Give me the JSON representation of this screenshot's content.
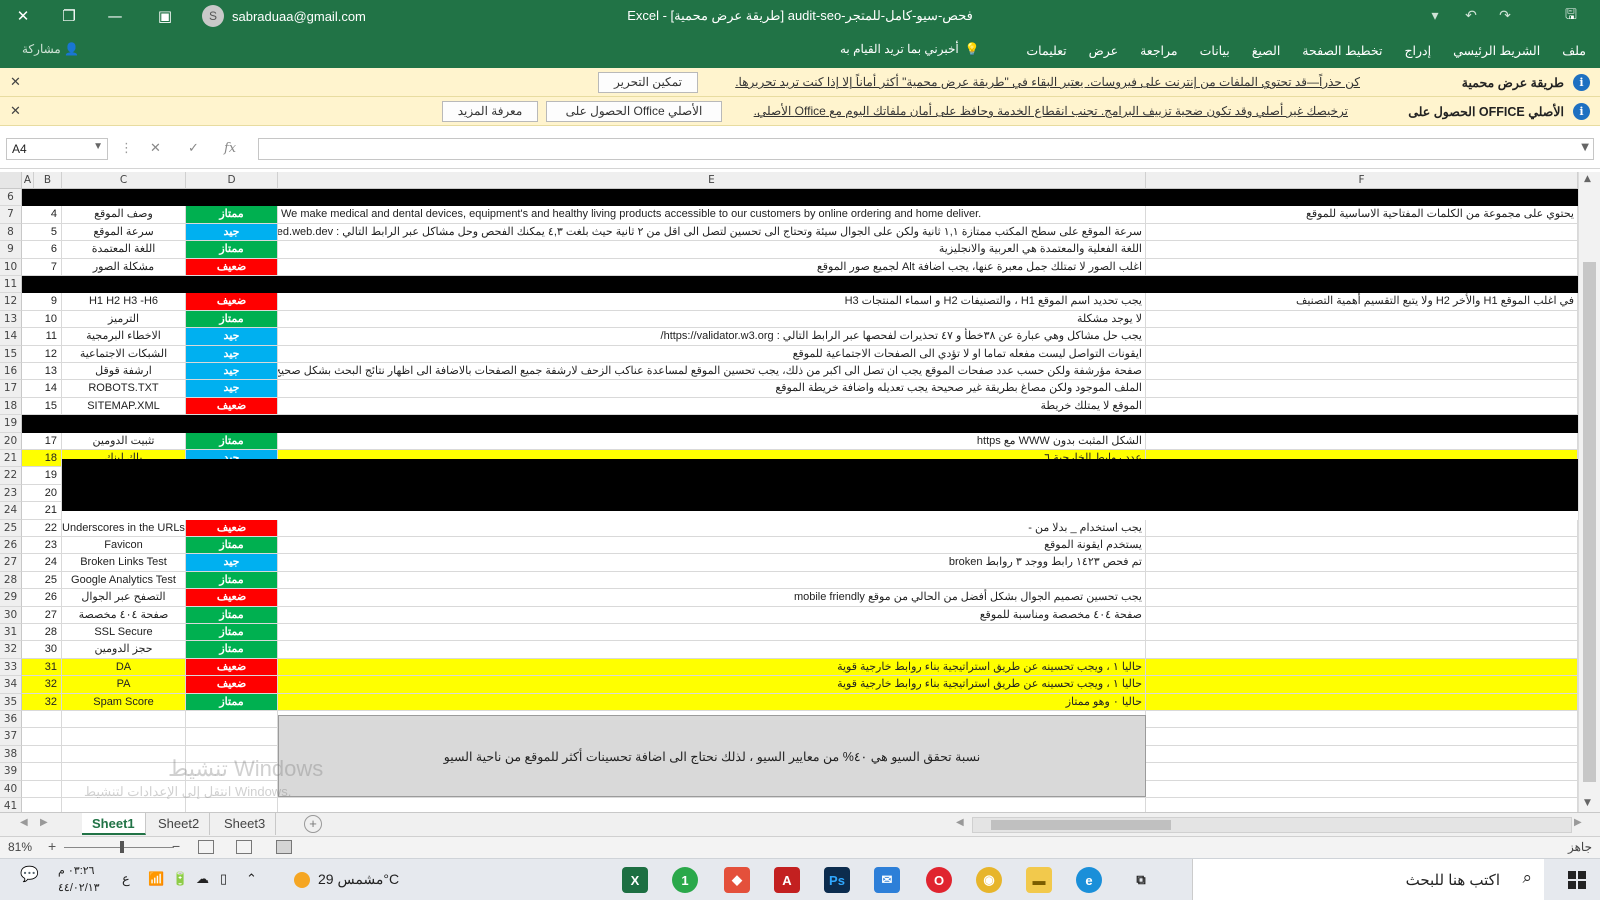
{
  "titlebar": {
    "account_email": "sabraduaa@gmail.com",
    "avatar_initial": "S",
    "document_title": "Excel - [طريقة عرض محمية] audit-seo-فحص-سيو-كامل-للمتجر"
  },
  "ribbon": {
    "share_label": "مشاركة",
    "tell_me": "أخبرني بما تريد القيام به",
    "tabs": [
      "ملف",
      "الشريط الرئيسي",
      "إدراج",
      "تخطيط الصفحة",
      "الصيغ",
      "بيانات",
      "مراجعة",
      "عرض",
      "تعليمات"
    ]
  },
  "protected_bar": {
    "title": "طريقة عرض محمية",
    "message": "كن حذراً—قد تحتوي الملفات من إنترنت على فيروسات. يعتبر البقاء في \"طريقة عرض محمية\" أكثر أماناً إلا إذا كنت تريد تحريرها.",
    "button": "تمكين التحرير"
  },
  "office_bar": {
    "title": "الحصول على OFFICE الأصلي",
    "message": "ترخيصك غير أصلي وقد تكون ضحية تزييف البرامج. تجنب انقطاع الخدمة وحافظ على أمان ملفاتك اليوم مع Office الأصلي.",
    "button_primary": "الحصول على Office الأصلي",
    "button_secondary": "معرفة المزيد"
  },
  "formula_bar": {
    "name_box": "A4",
    "fx": "fx"
  },
  "columns": [
    "A",
    "B",
    "C",
    "D",
    "E",
    "F"
  ],
  "rows": [
    {
      "n": "6",
      "style": "black"
    },
    {
      "n": "7",
      "b": "4",
      "c": "وصف الموقع",
      "grade": "ممتاز",
      "g": "excellent",
      "e": "We make medical and dental devices, equipment's and healthy living products accessible to our customers by online ordering and home deliver.",
      "e_ltr": true,
      "f": "يحتوي على مجموعة من الكلمات المفتاحية الاساسية للموقع"
    },
    {
      "n": "8",
      "b": "5",
      "c": "سرعة الموقع",
      "grade": "جيد",
      "g": "good",
      "e": "سرعة الموقع على سطح المكتب ممتازة ١,١ ثانية ولكن على الجوال سيئة وتحتاج الى تحسين لتصل الى اقل من ٢ ثانية حيث بلغت ٤,٣ يمكنك الفحص وحل مشاكل عبر الرابط التالي : https://pagespeed.web.dev/",
      "f": ""
    },
    {
      "n": "9",
      "b": "6",
      "c": "اللغة المعتمدة",
      "grade": "ممتاز",
      "g": "excellent",
      "e": "اللغة الفعلية والمعتمدة هي العربية والانجليزية",
      "f": ""
    },
    {
      "n": "10",
      "b": "7",
      "c": "مشكلة الصور",
      "grade": "ضعيف",
      "g": "weak",
      "e": "اغلب الصور لا تمتلك جمل معبرة عنها، يجب اضافة Alt لجميع صور الموقع",
      "f": ""
    },
    {
      "n": "11",
      "style": "black"
    },
    {
      "n": "12",
      "b": "9",
      "c": "H1 H2 H3 -H6",
      "grade": "ضعيف",
      "g": "weak",
      "e": "يجب تحديد اسم الموقع H1 ، والتصنيفات H2 و اسماء المنتجات H3",
      "f": "في اغلب الموقع H1 والأخر H2 ولا يتبع التقسيم أهمية التصنيف"
    },
    {
      "n": "13",
      "b": "10",
      "c": "الترميز",
      "grade": "ممتاز",
      "g": "excellent",
      "e": "لا يوجد مشكلة",
      "f": ""
    },
    {
      "n": "14",
      "b": "11",
      "c": "الاخطاء البرمجية",
      "grade": "جيد",
      "g": "good",
      "e": "يجب حل مشاكل وهي عبارة عن ٣٨خطأ و ٤٧ تحذيرات لفحصها عبر الرابط التالي : https://validator.w3.org/",
      "f": ""
    },
    {
      "n": "15",
      "b": "12",
      "c": "الشبكات الاجتماعية",
      "grade": "جيد",
      "g": "good",
      "e": "ايقونات التواصل ليست مفعله تماما او لا تؤدي الى الصفحات الاجتماعية للموقع",
      "f": ""
    },
    {
      "n": "16",
      "b": "13",
      "c": "ارشفة قوقل",
      "grade": "جيد",
      "g": "good",
      "e": "صفحة مؤرشفة ولكن حسب عدد صفحات الموقع يجب ان تصل الى اكبر من ذلك، يجب تحسين الموقع لمساعدة عناكب الزحف لارشفة جميع الصفحات بالاضافة الى اظهار نتائج البحث بشكل صحيح عن طريق وضع وصف",
      "f": ""
    },
    {
      "n": "17",
      "b": "14",
      "c": "ROBOTS.TXT",
      "grade": "جيد",
      "g": "good",
      "e": "الملف الموجود ولكن مصاغ بطريقة غير صحيحة يجب تعديله واضافة خريطة الموقع",
      "f": ""
    },
    {
      "n": "18",
      "b": "15",
      "c": "SITEMAP.XML",
      "grade": "ضعيف",
      "g": "weak",
      "e": "الموقع لا يمتلك خريطة",
      "f": ""
    },
    {
      "n": "19",
      "style": "black"
    },
    {
      "n": "20",
      "b": "17",
      "c": "تثبيت الدومين",
      "grade": "ممتاز",
      "g": "excellent",
      "e": "الشكل المثبت بدون WWW مع https",
      "f": ""
    },
    {
      "n": "21",
      "b": "18",
      "c": "باك لينك",
      "grade": "جيد",
      "g": "good",
      "e": "عدد روابط الخارجية ٦",
      "f": "",
      "style": "yellow"
    },
    {
      "n": "22",
      "b": "19",
      "style": "blockrow"
    },
    {
      "n": "23",
      "b": "20",
      "style": "blockrow"
    },
    {
      "n": "24",
      "b": "21",
      "style": "blockrow"
    },
    {
      "n": "25",
      "b": "22",
      "c": "Underscores in the URLs",
      "grade": "ضعيف",
      "g": "weak",
      "e": "يجب استخدام _ بدلا من -",
      "f": ""
    },
    {
      "n": "26",
      "b": "23",
      "c": "Favicon",
      "grade": "ممتاز",
      "g": "excellent",
      "e": "يستخدم ايقونة الموقع",
      "f": ""
    },
    {
      "n": "27",
      "b": "24",
      "c": "Broken Links Test",
      "grade": "جيد",
      "g": "good",
      "e": "تم فحص ١٤٢٣ رابط ووجد ٣ روابط broken",
      "f": ""
    },
    {
      "n": "28",
      "b": "25",
      "c": "Google Analytics Test",
      "grade": "ممتاز",
      "g": "excellent",
      "e": "",
      "f": ""
    },
    {
      "n": "29",
      "b": "26",
      "c": "التصفح عبر الجوال",
      "grade": "ضعيف",
      "g": "weak",
      "e": "يجب تحسين تصميم الجوال بشكل أفضل من الحالي من موقع mobile friendly",
      "f": ""
    },
    {
      "n": "30",
      "b": "27",
      "c": "صفحة ٤٠٤ مخصصة",
      "grade": "ممتاز",
      "g": "excellent",
      "e": "صفحة ٤٠٤ مخصصة ومناسبة للموقع",
      "f": ""
    },
    {
      "n": "31",
      "b": "28",
      "c": "SSL Secure",
      "grade": "ممتاز",
      "g": "excellent",
      "e": "",
      "f": ""
    },
    {
      "n": "32",
      "b": "30",
      "c": "حجز الدومين",
      "grade": "ممتاز",
      "g": "excellent",
      "e": "",
      "f": ""
    },
    {
      "n": "33",
      "b": "31",
      "c": "DA",
      "grade": "ضعيف",
      "g": "weak",
      "e": "حاليا ١ ، ويجب تحسينه عن طريق استراتيجية بناء روابط خارجية قوية",
      "f": "",
      "style": "yellow"
    },
    {
      "n": "34",
      "b": "32",
      "c": "PA",
      "grade": "ضعيف",
      "g": "weak",
      "e": "حاليا ١ ، ويجب تحسينه عن طريق استراتيجية بناء روابط خارجية قوية",
      "f": "",
      "style": "yellow"
    },
    {
      "n": "35",
      "b": "32",
      "c": "Spam Score",
      "grade": "ممتاز",
      "g": "excellent",
      "e": "حاليا ٠ وهو ممتاز",
      "f": "",
      "style": "yellow"
    },
    {
      "n": "36"
    },
    {
      "n": "37"
    },
    {
      "n": "38"
    },
    {
      "n": "39"
    },
    {
      "n": "40"
    },
    {
      "n": "41"
    }
  ],
  "summary": "نسبة تحقق السيو هي ٤٠% من معايير السيو ، لذلك نحتاج الى اضافة تحسينات أكثر للموقع من ناحية السيو",
  "watermark": {
    "activate": "تنشيط Windows",
    "activate_sub": "انتقل إلى الإعدادات لتنشيط Windows."
  },
  "sheets": [
    "Sheet1",
    "Sheet2",
    "Sheet3"
  ],
  "status": {
    "zoom": "81%",
    "ready": "جاهز"
  },
  "taskbar": {
    "search_placeholder": "اكتب هنا للبحث",
    "weather": "مشمس 29°C",
    "time": "٠٣:٢٦ م",
    "date": "٤٤/٠٢/١٣",
    "lang": "ع"
  },
  "colors": {
    "excel_green": "#217346",
    "excellent": "#00b050",
    "good": "#00b0f0",
    "weak": "#ff0000",
    "highlight": "#ffff00"
  }
}
